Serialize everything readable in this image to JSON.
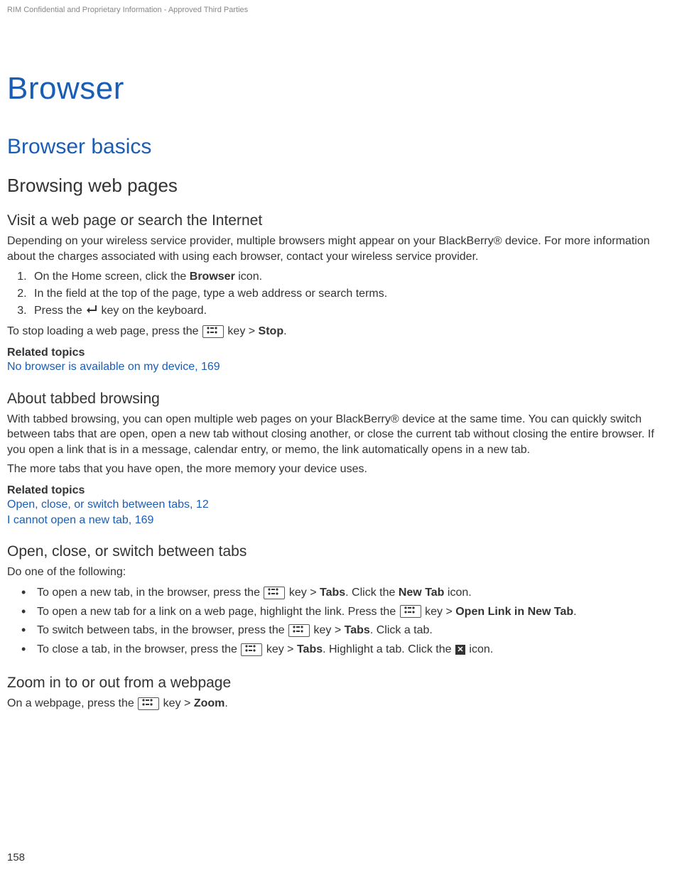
{
  "header": {
    "confidential": "RIM Confidential and Proprietary Information - Approved Third Parties"
  },
  "title": "Browser",
  "h2_basics": "Browser basics",
  "h3_browsing": "Browsing web pages",
  "visit": {
    "heading": "Visit a web page or search the Internet",
    "intro": "Depending on your wireless service provider, multiple browsers might appear on your BlackBerry® device. For more information about the charges associated with using each browser, contact your wireless service provider.",
    "step1_a": "On the Home screen, click the ",
    "step1_b": "Browser",
    "step1_c": " icon.",
    "step2": "In the field at the top of the page, type a web address or search terms.",
    "step3_a": "Press the ",
    "step3_b": " key on the keyboard.",
    "stop_a": "To stop loading a web page, press the ",
    "stop_b": " key > ",
    "stop_c": "Stop",
    "stop_d": ".",
    "related_hdr": "Related topics",
    "related_link": "No browser is available on my device, 169"
  },
  "tabbed": {
    "heading": "About tabbed browsing",
    "p1": "With tabbed browsing, you can open multiple web pages on your BlackBerry® device at the same time. You can quickly switch between tabs that are open, open a new tab without closing another, or close the current tab without closing the entire browser. If you open a link that is in a message, calendar entry, or memo, the link automatically opens in a new tab.",
    "p2": "The more tabs that you have open, the more memory your device uses.",
    "related_hdr": "Related topics",
    "related_link1": "Open, close, or switch between tabs, 12",
    "related_link2": "I cannot open a new tab, 169"
  },
  "openclose": {
    "heading": "Open, close, or switch between tabs",
    "intro": "Do one of the following:",
    "b1_a": "To open a new tab, in the browser, press the ",
    "b1_b": " key > ",
    "b1_c": "Tabs",
    "b1_d": ". Click the ",
    "b1_e": "New Tab",
    "b1_f": " icon.",
    "b2_a": "To open a new tab for a link on a web page, highlight the link. Press the ",
    "b2_b": " key > ",
    "b2_c": "Open Link in New Tab",
    "b2_d": ".",
    "b3_a": "To switch between tabs, in the browser, press the ",
    "b3_b": " key > ",
    "b3_c": "Tabs",
    "b3_d": ". Click a tab.",
    "b4_a": "To close a tab, in the browser, press the ",
    "b4_b": " key > ",
    "b4_c": "Tabs",
    "b4_d": ". Highlight a tab. Click the ",
    "b4_e": " icon."
  },
  "zoom": {
    "heading": "Zoom in to or out from a webpage",
    "p_a": "On a webpage, press the ",
    "p_b": " key > ",
    "p_c": "Zoom",
    "p_d": "."
  },
  "page_number": "158"
}
